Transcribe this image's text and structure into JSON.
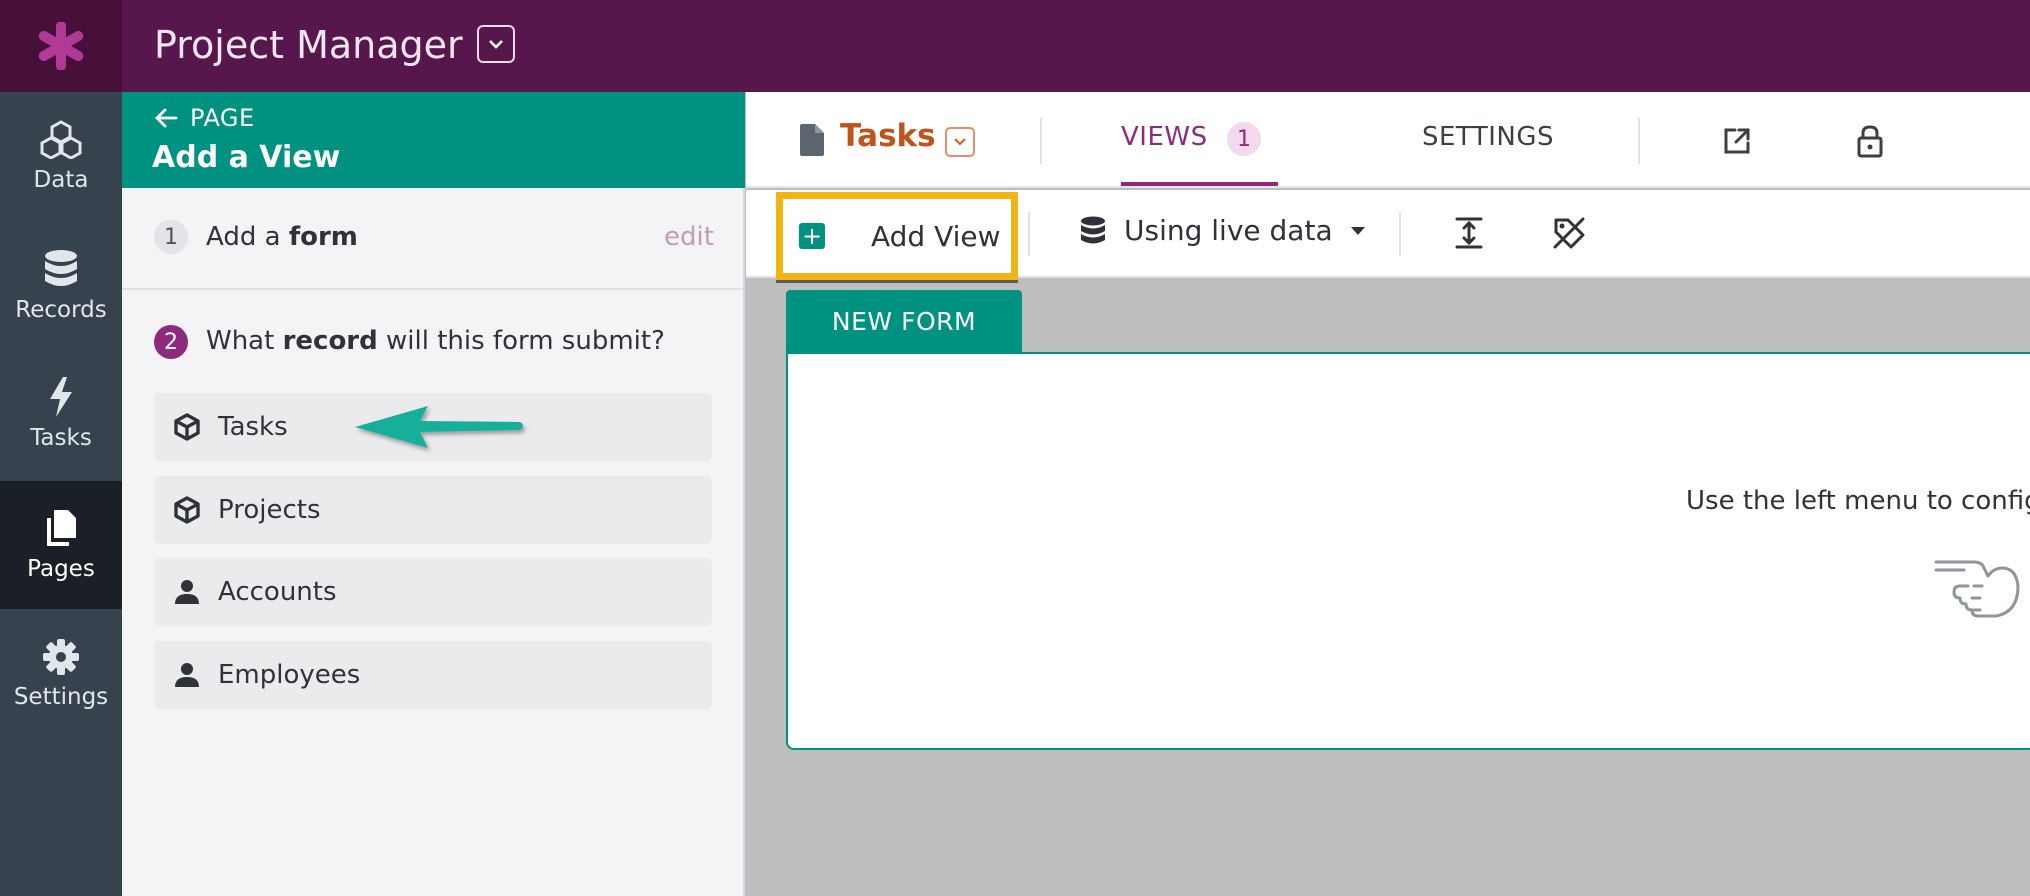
{
  "app": {
    "title": "Project Manager",
    "colors": {
      "topbar": "#57164c",
      "accent": "#009280",
      "highlight": "#f1b513",
      "brand": "#8e2a7e"
    }
  },
  "nav": {
    "items": [
      {
        "label": "Data",
        "icon": "cubes-icon"
      },
      {
        "label": "Records",
        "icon": "database-icon"
      },
      {
        "label": "Tasks",
        "icon": "bolt-icon"
      },
      {
        "label": "Pages",
        "icon": "pages-icon",
        "active": true
      },
      {
        "label": "Settings",
        "icon": "gear-icon"
      }
    ]
  },
  "panel": {
    "back_label": "PAGE",
    "title": "Add a View",
    "step1": {
      "number": "1",
      "prefix": "Add a ",
      "bold": "form",
      "edit_label": "edit"
    },
    "step2": {
      "number": "2",
      "prefix": "What ",
      "bold": "record",
      "suffix": " will this form submit?"
    },
    "choices": [
      {
        "label": "Tasks",
        "icon": "cube-icon"
      },
      {
        "label": "Projects",
        "icon": "cube-icon"
      },
      {
        "label": "Accounts",
        "icon": "person-icon"
      },
      {
        "label": "Employees",
        "icon": "person-icon"
      }
    ]
  },
  "tabs": {
    "page_name": "Tasks",
    "views_label": "VIEWS",
    "views_count": "1",
    "settings_label": "SETTINGS"
  },
  "toolbar": {
    "add_view_label": "Add View",
    "data_source_label": "Using live data"
  },
  "canvas": {
    "form_tab_label": "NEW FORM",
    "hint_text": "Use the left menu to configure"
  }
}
